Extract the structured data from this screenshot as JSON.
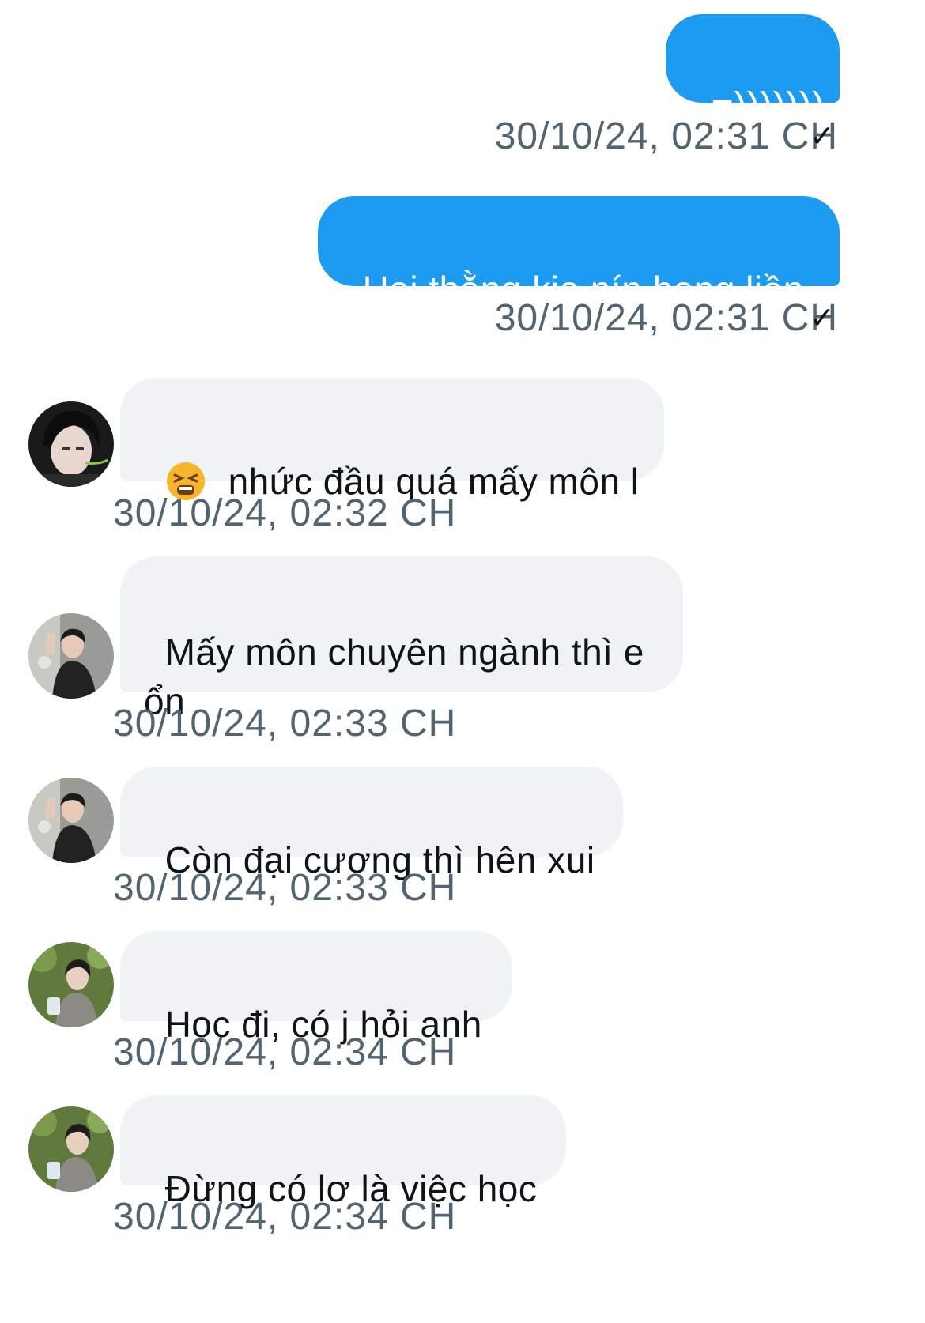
{
  "messages": [
    {
      "direction": "sent",
      "text": "=)))))))",
      "timestamp": "30/10/24, 02:31 CH",
      "status": "✓"
    },
    {
      "direction": "sent",
      "text": "Hai thằng kia nín họng liền",
      "timestamp": "30/10/24, 02:31 CH",
      "status": "✓"
    },
    {
      "direction": "received",
      "emoji": "tired-face-emoji",
      "text": "nhức đầu quá mấy môn l",
      "timestamp": "30/10/24, 02:32 CH",
      "avatar": "avatar-dark-hair-headset"
    },
    {
      "direction": "received",
      "text": "Mấy môn chuyên ngành thì e ổn",
      "timestamp": "30/10/24, 02:33 CH",
      "avatar": "avatar-peace-sign"
    },
    {
      "direction": "received",
      "text": "Còn đại cương thì hên xui",
      "timestamp": "30/10/24, 02:33 CH",
      "avatar": "avatar-peace-sign"
    },
    {
      "direction": "received",
      "text": "Học đi, có j hỏi anh",
      "timestamp": "30/10/24, 02:34 CH",
      "avatar": "avatar-outdoor-greenery"
    },
    {
      "direction": "received",
      "text": "Đừng có lơ là việc học",
      "timestamp": "30/10/24, 02:34 CH",
      "avatar": "avatar-outdoor-greenery"
    }
  ],
  "colors": {
    "sent_bubble": "#1d9bf0",
    "received_bubble": "#eff3f4",
    "timestamp": "#536471"
  }
}
